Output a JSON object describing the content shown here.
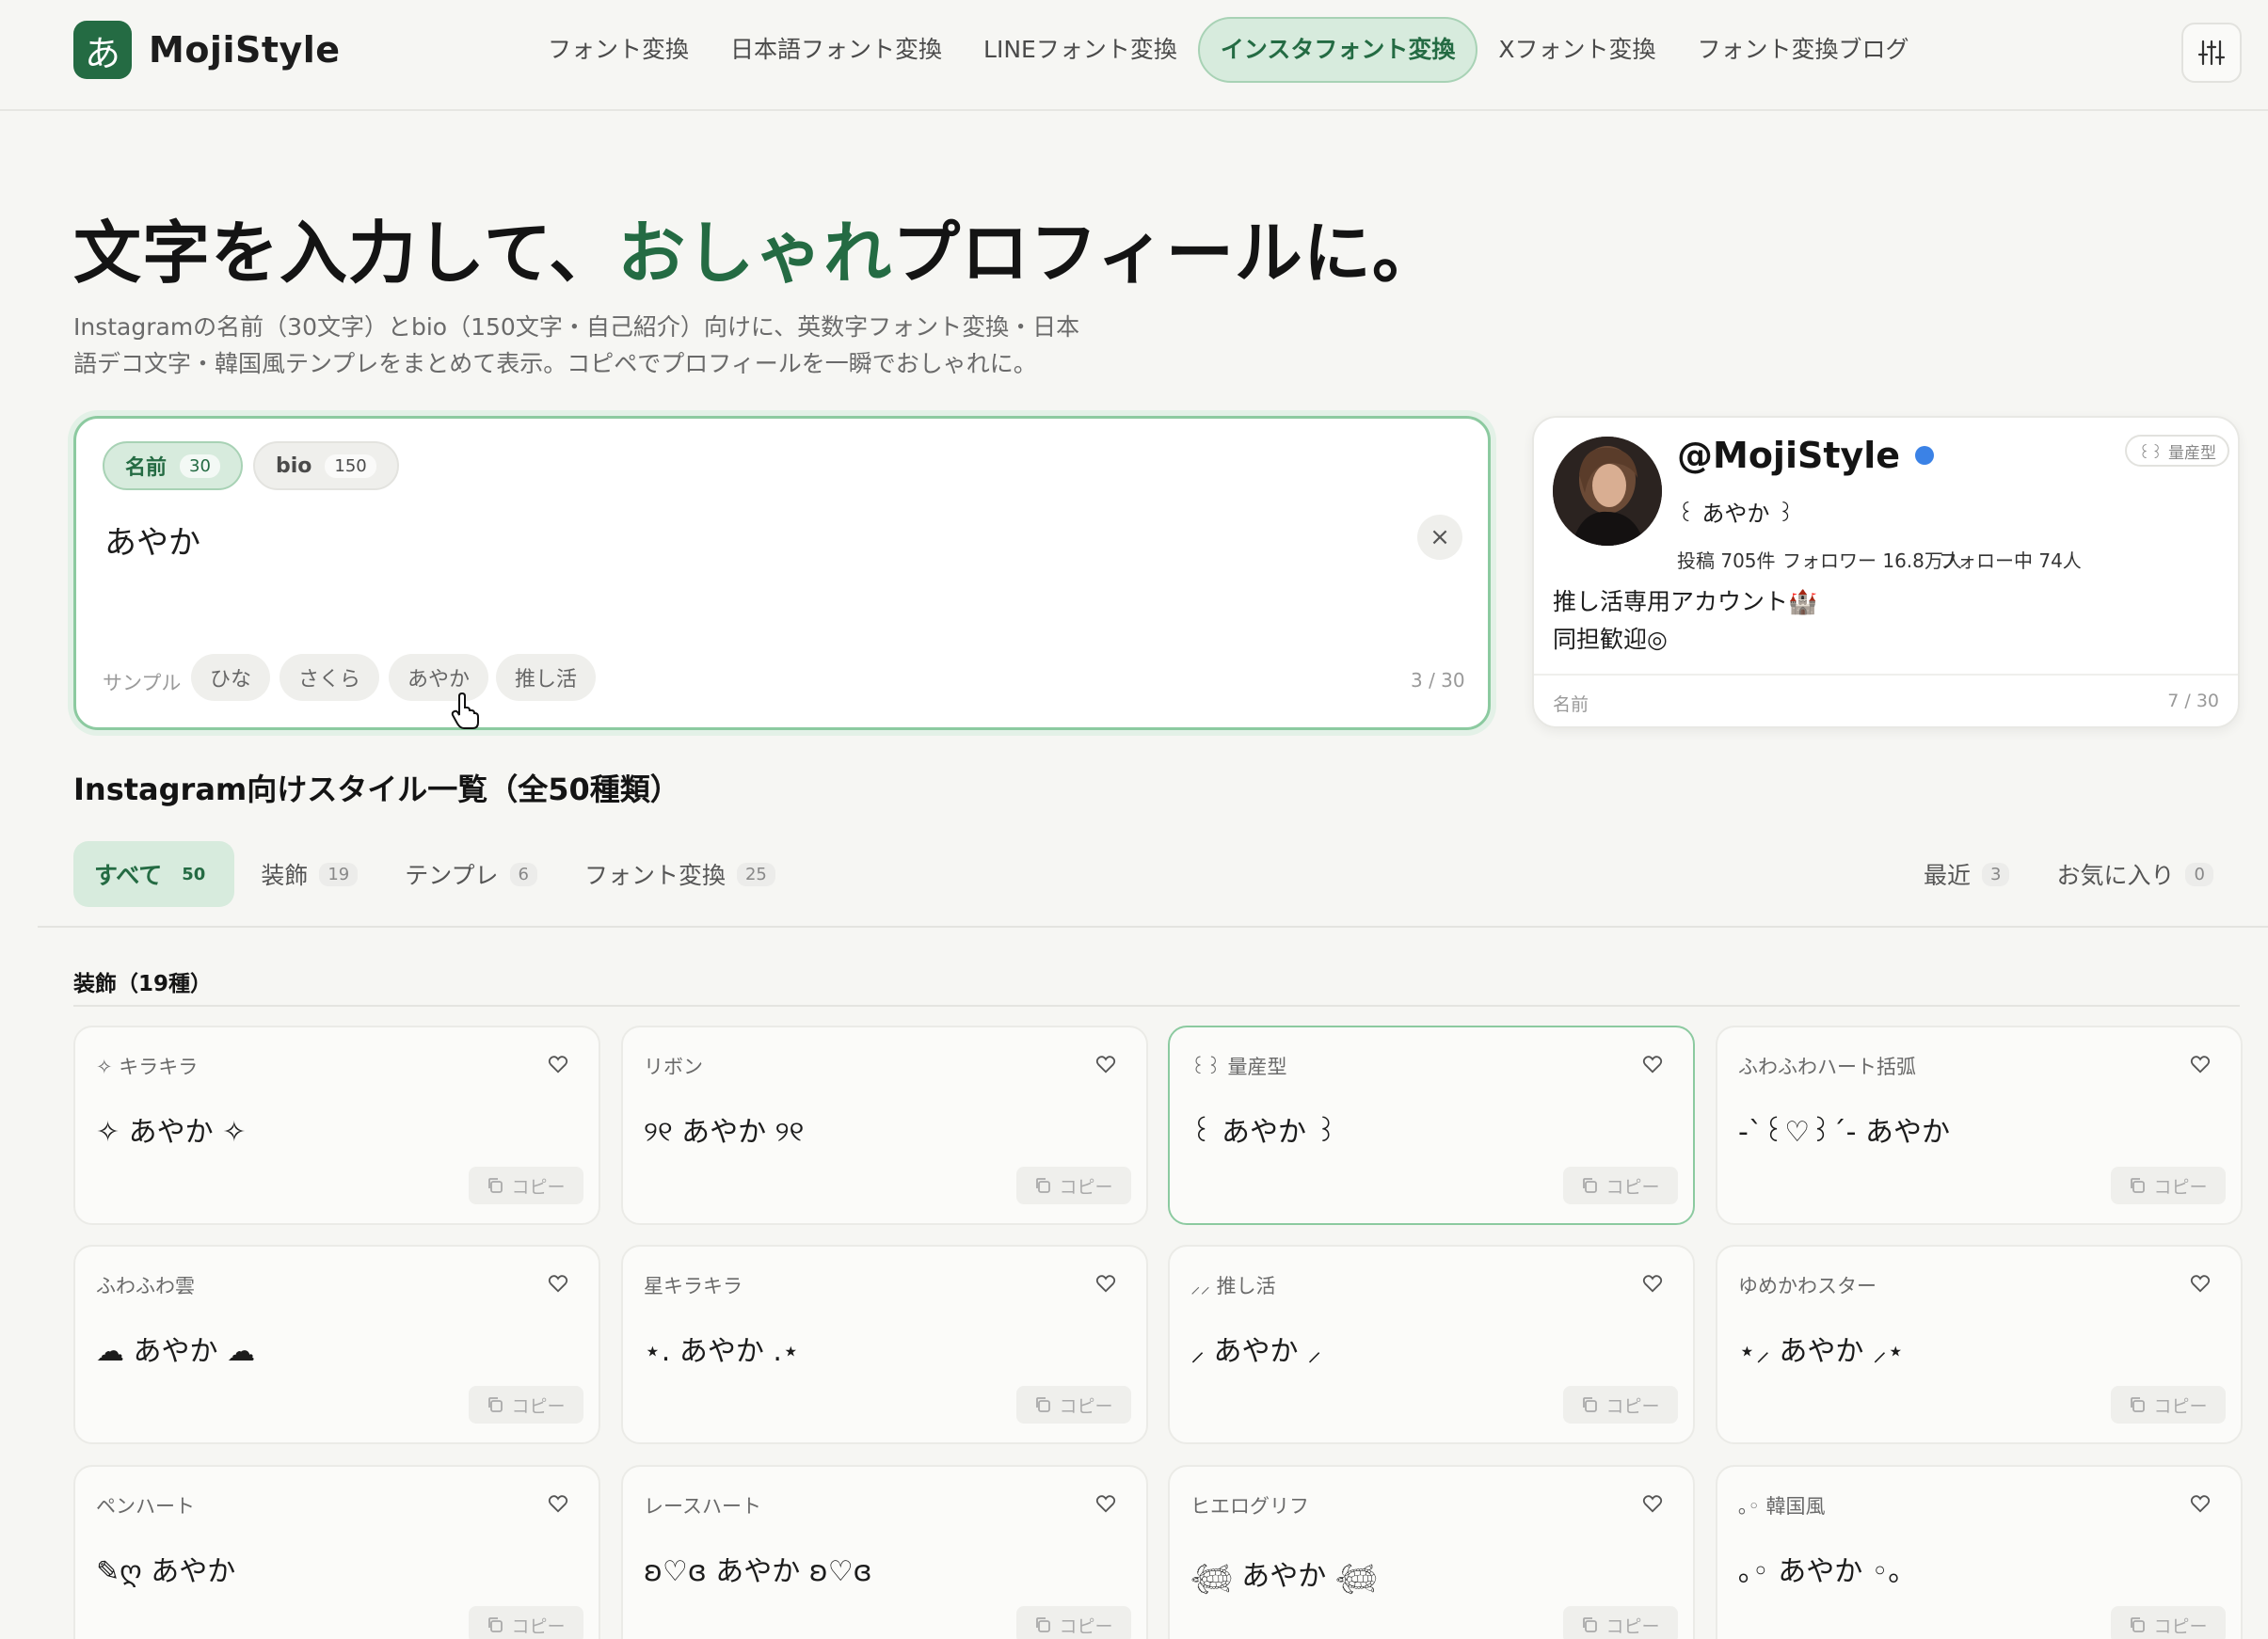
{
  "header": {
    "logo_mark": "あ",
    "logo_text": "MojiStyle",
    "nav": [
      "フォント変換",
      "日本語フォント変換",
      "LINEフォント変換",
      "インスタフォント変換",
      "Xフォント変換",
      "フォント変換ブログ"
    ],
    "active_nav": "インスタフォント変換"
  },
  "hero": {
    "title_before": "文字を入力して、",
    "title_accent": "おしゃれ",
    "title_after": "プロフィールに。",
    "subtitle_line1": "Instagramの名前（30文字）とbio（150文字・自己紹介）向けに、英数字フォント変換・日本",
    "subtitle_line2": "語デコ文字・韓国風テンプレをまとめて表示。コピペでプロフィールを一瞬でおしゃれに。"
  },
  "editor": {
    "tab_name_label": "名前",
    "tab_name_count": "30",
    "tab_bio_label": "bio",
    "tab_bio_count": "150",
    "input_value": "あやか",
    "clear_icon": "×",
    "samples_label": "サンプル",
    "samples": [
      "ひな",
      "さくら",
      "あやか",
      "推し活"
    ],
    "char_count": "3 / 30"
  },
  "preview": {
    "handle": "@MojiStyle",
    "badge": "꒰꒱ 量産型",
    "name": "꒰ あやか ꒱",
    "posts": "投稿 705件",
    "followers": "フォロワー 16.8万人",
    "following": "フォロー中 74人",
    "bio_line1": "推し活専用アカウント🏰",
    "bio_line2": "同担歓迎◎",
    "footer_label": "名前",
    "footer_count": "7 / 30",
    "verified_color": "#3b82e6"
  },
  "list": {
    "title": "Instagram向けスタイル一覧（全50種類）",
    "tabs": [
      {
        "label": "すべて",
        "count": "50"
      },
      {
        "label": "装飾",
        "count": "19"
      },
      {
        "label": "テンプレ",
        "count": "6"
      },
      {
        "label": "フォント変換",
        "count": "25"
      }
    ],
    "right_tabs": [
      {
        "label": "最近",
        "count": "3"
      },
      {
        "label": "お気に入り",
        "count": "0"
      }
    ],
    "group_title": "装飾（19種）",
    "copy_label": "コピー",
    "cards": [
      {
        "title": "✧ キラキラ",
        "value": "✧ あやか ✧"
      },
      {
        "title": "リボン",
        "value": "୨୧ あやか ୨୧"
      },
      {
        "title": "꒰꒱ 量産型",
        "value": "꒰ あやか ꒱"
      },
      {
        "title": "ふわふわハート括弧",
        "value": "-`꒰♡꒱´- あやか"
      },
      {
        "title": "ふわふわ雲",
        "value": "☁ あやか ☁"
      },
      {
        "title": "星キラキラ",
        "value": "⋆. あやか .⋆"
      },
      {
        "title": "⸝⸝ 推し活",
        "value": "⸝ あやか ⸝"
      },
      {
        "title": "ゆめかわスター",
        "value": "⋆⸝ あやか ⸝⋆"
      },
      {
        "title": "ペンハート",
        "value": "✎ღ あやか"
      },
      {
        "title": "レースハート",
        "value": "ʚ♡ɞ あやか ʚ♡ɞ"
      },
      {
        "title": "ヒエログリフ",
        "value": "𓆉 あやか 𓆉"
      },
      {
        "title": "｡◦ 韓国風",
        "value": "｡◦ あやか ◦｡"
      }
    ]
  },
  "colors": {
    "accent": "#246b43",
    "accent_bg": "#d7ebdd",
    "page_bg": "#f6f6f3"
  }
}
